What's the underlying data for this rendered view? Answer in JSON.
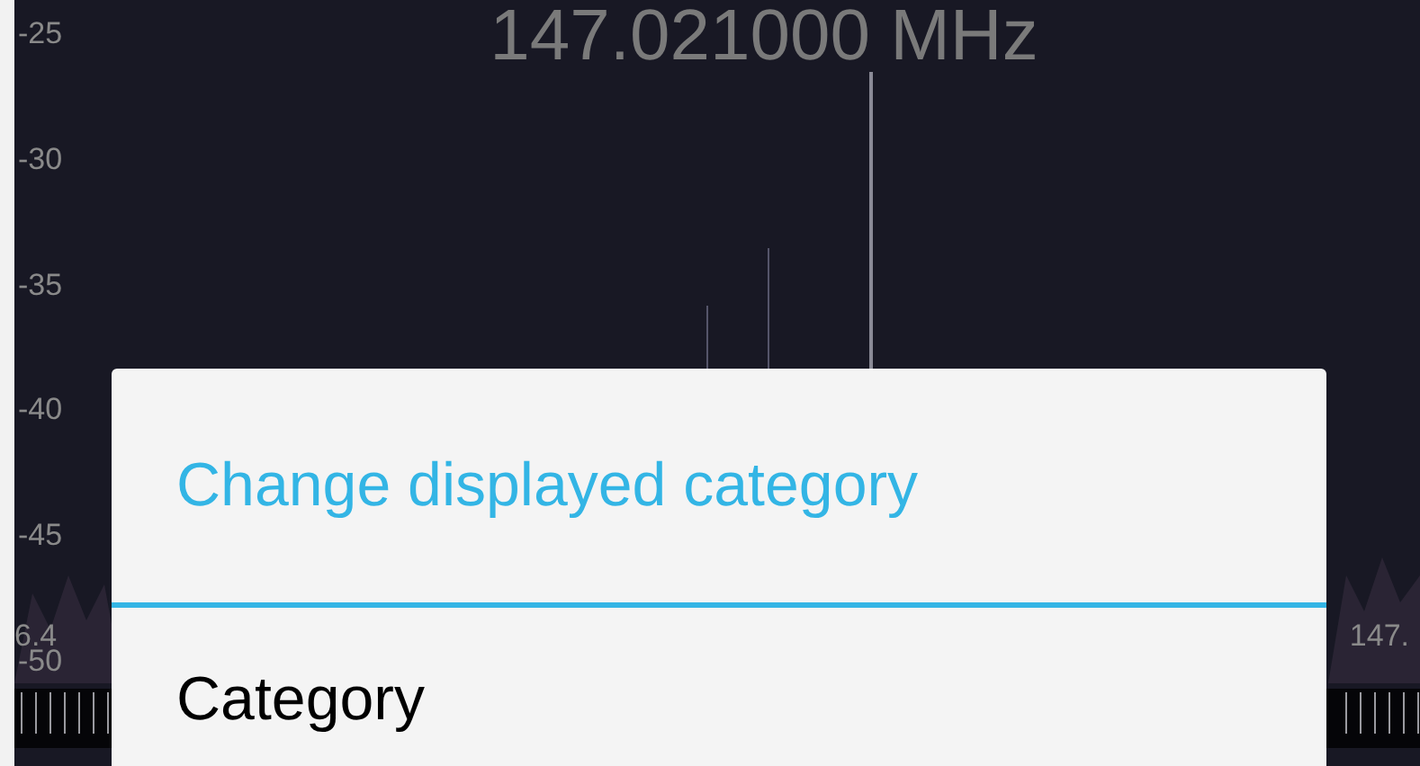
{
  "spectrum": {
    "frequency": "147.021000 MHz",
    "db_labels": [
      "-25",
      "-30",
      "-35",
      "-40",
      "-45",
      "-50"
    ],
    "freq_labels": [
      "6.4",
      "147."
    ]
  },
  "dialog": {
    "title": "Change displayed category",
    "items": [
      "Category"
    ]
  }
}
